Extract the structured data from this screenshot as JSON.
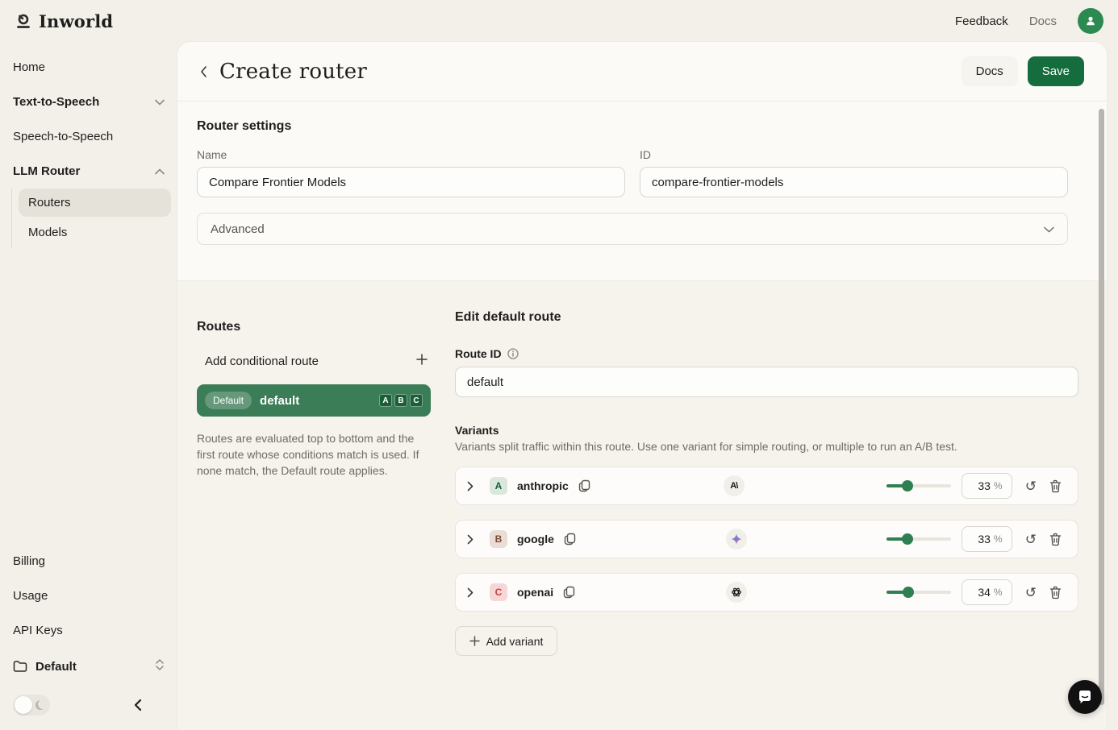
{
  "topbar": {
    "brand": "Inworld",
    "feedback_label": "Feedback",
    "docs_label": "Docs"
  },
  "sidebar": {
    "home": "Home",
    "tts": "Text-to-Speech",
    "sts": "Speech-to-Speech",
    "llm_router": "LLM Router",
    "routers": "Routers",
    "models": "Models",
    "billing": "Billing",
    "usage": "Usage",
    "api_keys": "API Keys",
    "workspace": "Default"
  },
  "header": {
    "title": "Create router",
    "docs_label": "Docs",
    "save_label": "Save"
  },
  "router_settings": {
    "heading": "Router settings",
    "name_label": "Name",
    "name_value": "Compare Frontier Models",
    "id_label": "ID",
    "id_value": "compare-frontier-models",
    "advanced_label": "Advanced"
  },
  "routes": {
    "heading": "Routes",
    "add_conditional_label": "Add conditional route",
    "default_badge": "Default",
    "default_name": "default",
    "variant_letters": {
      "a": "A",
      "b": "B",
      "c": "C"
    },
    "helper": "Routes are evaluated top to bottom and the first route whose conditions match is used. If none match, the Default route applies."
  },
  "edit_route": {
    "heading": "Edit default route",
    "route_id_label": "Route ID",
    "route_id_value": "default",
    "variants_heading": "Variants",
    "variants_description": "Variants split traffic within this route. Use one variant for simple routing, or multiple to run an A/B test.",
    "percent_unit": "%",
    "variants": [
      {
        "letter": "A",
        "name": "anthropic",
        "provider_icon": "anthropic-logo",
        "percent": "33"
      },
      {
        "letter": "B",
        "name": "google",
        "provider_icon": "gemini-logo",
        "percent": "33"
      },
      {
        "letter": "C",
        "name": "openai",
        "provider_icon": "openai-logo",
        "percent": "34"
      }
    ],
    "add_variant_label": "Add variant"
  },
  "colors": {
    "accent_green": "#156c3c",
    "route_card_green": "#3b7d57",
    "avatar_green": "#2b8a4f",
    "page_bg": "#f3f0ea",
    "panel_bg": "#fbfaf7"
  }
}
